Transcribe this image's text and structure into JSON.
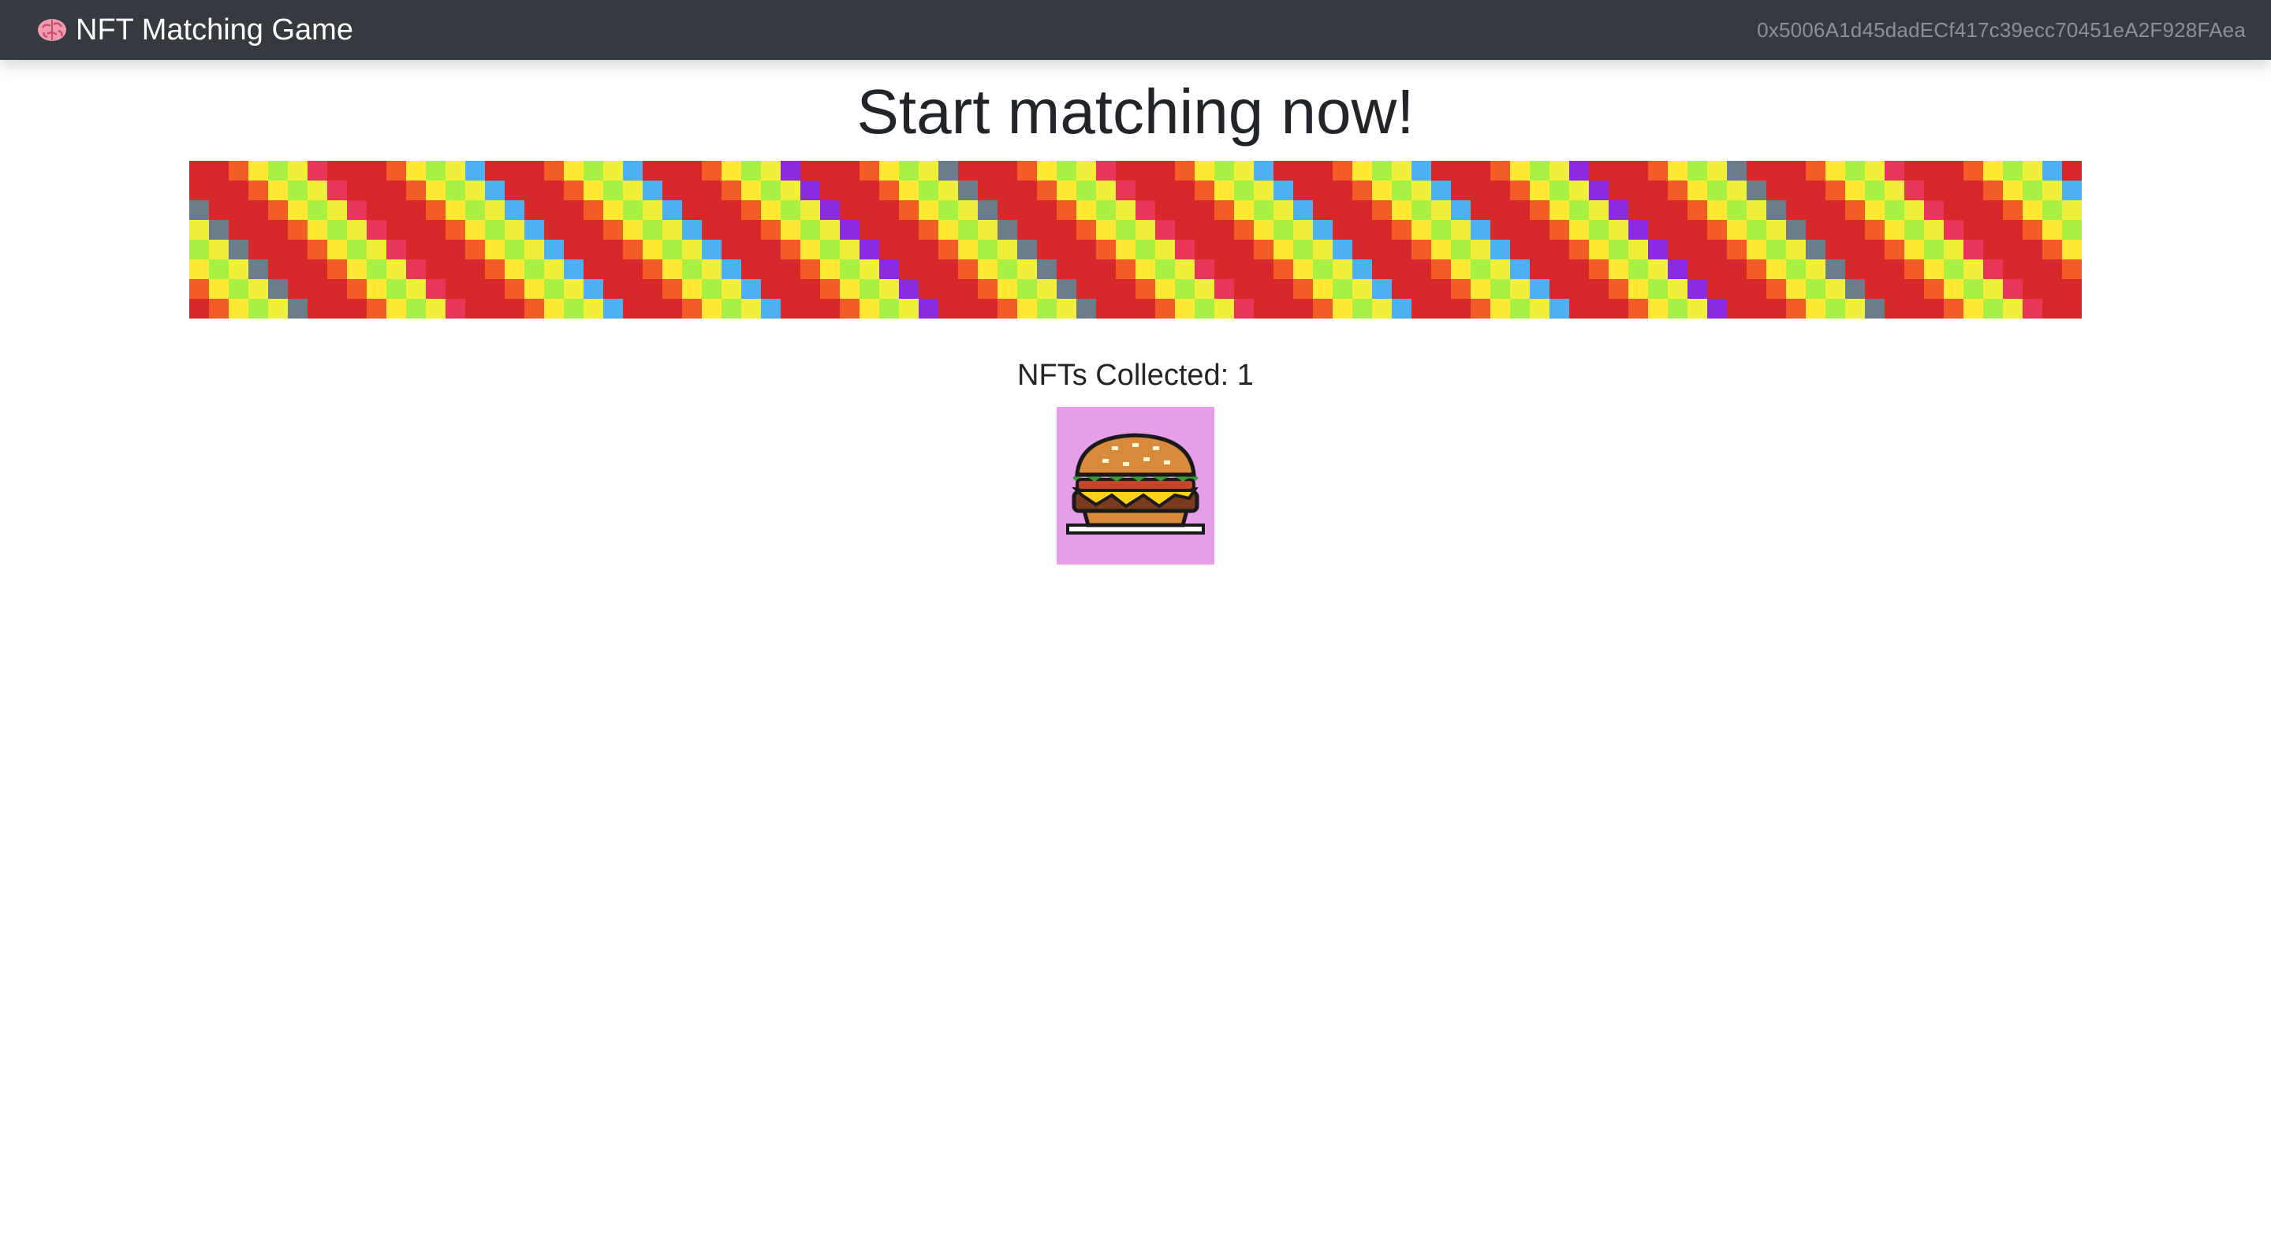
{
  "navbar": {
    "brand_label": "NFT Matching Game",
    "brand_icon": "brain-icon",
    "account_address": "0x5006A1d45dadECf417c39ecc70451eA2F928FAea"
  },
  "main": {
    "heading": "Start matching now!",
    "card_grid": {
      "rows": 8,
      "columns": 96,
      "palette": [
        "#d7282c",
        "#f25c27",
        "#ffe933",
        "#a7f043",
        "#e7e73d",
        "#4cb0f3",
        "#8a2be2",
        "#6b7d8a",
        "#e8365a",
        "#f0f03a"
      ]
    },
    "collected_label": "NFTs Collected: 1",
    "collected_count": 1,
    "collected_items": [
      {
        "name": "burger-nft",
        "background": "#e59ee7"
      }
    ]
  }
}
